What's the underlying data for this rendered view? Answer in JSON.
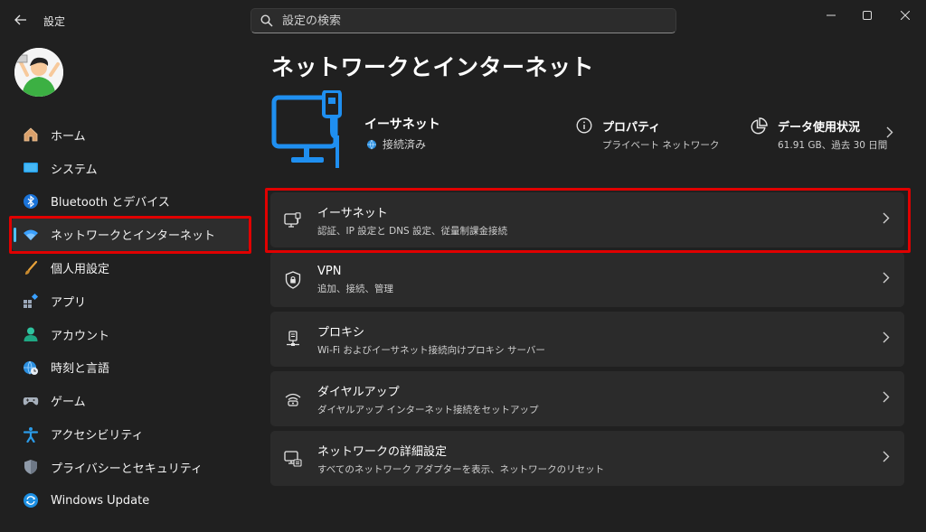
{
  "window": {
    "title": "設定",
    "back_icon": "back-arrow-icon",
    "minimize_icon": "minimize-icon",
    "maximize_icon": "maximize-icon",
    "close_icon": "close-icon"
  },
  "search": {
    "placeholder": "設定の検索",
    "value": ""
  },
  "sidebar": {
    "items": [
      {
        "label": "ホーム",
        "icon": "home-icon"
      },
      {
        "label": "システム",
        "icon": "system-monitor-icon"
      },
      {
        "label": "Bluetooth とデバイス",
        "icon": "bluetooth-icon"
      },
      {
        "label": "ネットワークとインターネット",
        "icon": "wifi-icon",
        "selected": true
      },
      {
        "label": "個人用設定",
        "icon": "brush-icon"
      },
      {
        "label": "アプリ",
        "icon": "apps-icon"
      },
      {
        "label": "アカウント",
        "icon": "account-icon"
      },
      {
        "label": "時刻と言語",
        "icon": "globe-clock-icon"
      },
      {
        "label": "ゲーム",
        "icon": "gamepad-icon"
      },
      {
        "label": "アクセシビリティ",
        "icon": "accessibility-icon"
      },
      {
        "label": "プライバシーとセキュリティ",
        "icon": "shield-icon"
      },
      {
        "label": "Windows Update",
        "icon": "update-icon"
      }
    ]
  },
  "main": {
    "title": "ネットワークとインターネット",
    "connection": {
      "name": "イーサネット",
      "status": "接続済み",
      "icon": "ethernet-monitor-icon"
    },
    "properties": {
      "title": "プロパティ",
      "subtitle": "プライベート ネットワーク",
      "icon": "info-icon"
    },
    "data_usage": {
      "title": "データ使用状況",
      "subtitle": "61.91 GB、過去 30 日間",
      "icon": "pie-chart-icon"
    },
    "cards": [
      {
        "title": "イーサネット",
        "subtitle": "認証、IP 設定と DNS 設定、従量制課金接続",
        "icon": "ethernet-icon"
      },
      {
        "title": "VPN",
        "subtitle": "追加、接続、管理",
        "icon": "vpn-shield-icon"
      },
      {
        "title": "プロキシ",
        "subtitle": "Wi-Fi およびイーサネット接続向けプロキシ サーバー",
        "icon": "proxy-icon"
      },
      {
        "title": "ダイヤルアップ",
        "subtitle": "ダイヤルアップ インターネット接続をセットアップ",
        "icon": "dialup-icon"
      },
      {
        "title": "ネットワークの詳細設定",
        "subtitle": "すべてのネットワーク アダプターを表示、ネットワークのリセット",
        "icon": "network-advanced-icon"
      }
    ]
  },
  "colors": {
    "accent": "#4cc2ff",
    "highlight_box": "#e00000",
    "icon_blue": "#1e90ff"
  }
}
